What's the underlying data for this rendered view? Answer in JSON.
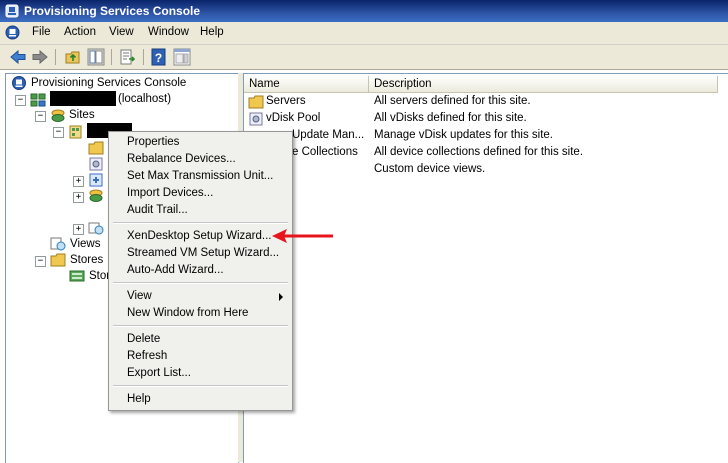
{
  "window": {
    "title": "Provisioning Services Console"
  },
  "menubar": {
    "items": [
      "File",
      "Action",
      "View",
      "Window",
      "Help"
    ]
  },
  "tree": {
    "root": "Provisioning Services Console",
    "server_suffix": "(localhost)",
    "sites": "Sites",
    "views": "Views",
    "stores": "Stores",
    "store_child": "Stor"
  },
  "list": {
    "columns": [
      "Name",
      "Description"
    ],
    "rows": [
      {
        "name": "Servers",
        "description": "All servers defined for this site."
      },
      {
        "name": "vDisk Pool",
        "description": "All vDisks defined for this site."
      },
      {
        "name": "Update Man...",
        "description": "Manage vDisk updates for this site."
      },
      {
        "name": "e Collections",
        "description": "All device collections defined for this site."
      },
      {
        "name": "",
        "description": "Custom device views."
      }
    ]
  },
  "context_menu": {
    "items": [
      "Properties",
      "Rebalance Devices...",
      "Set Max Transmission Unit...",
      "Import Devices...",
      "Audit Trail...",
      "XenDesktop Setup Wizard...",
      "Streamed VM Setup Wizard...",
      "Auto-Add Wizard...",
      "View",
      "New Window from Here",
      "Delete",
      "Refresh",
      "Export List...",
      "Help"
    ]
  },
  "colors": {
    "annotation_arrow": "#e8141b",
    "title_bar": "#0a246a"
  }
}
